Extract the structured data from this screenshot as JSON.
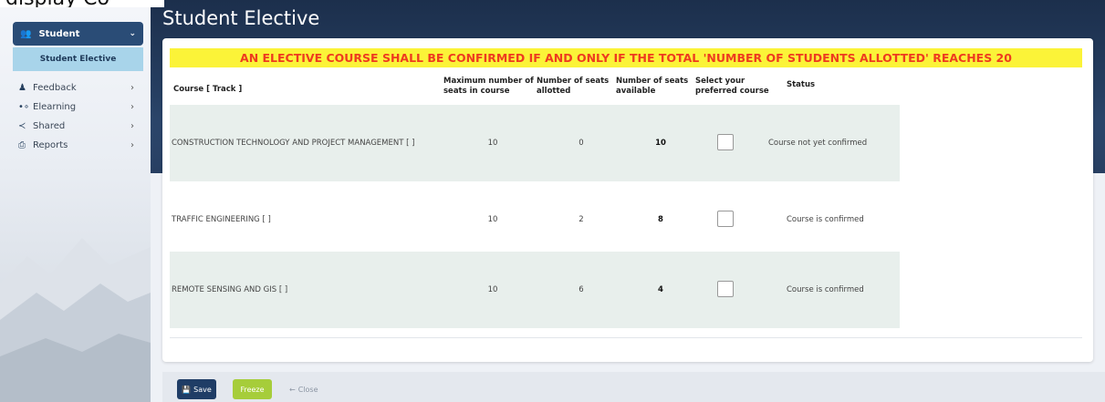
{
  "page": {
    "title": "Student Elective"
  },
  "top_clip_text": "display Co",
  "sidebar": {
    "active": {
      "label": "Student",
      "icon": "users-icon"
    },
    "sub_item": {
      "label": "Student Elective"
    },
    "items": [
      {
        "label": "Feedback",
        "icon": "person-icon"
      },
      {
        "label": "Elearning",
        "icon": "elearning-icon"
      },
      {
        "label": "Shared",
        "icon": "share-icon"
      },
      {
        "label": "Reports",
        "icon": "printer-icon"
      }
    ]
  },
  "banner": "AN ELECTIVE COURSE SHALL BE CONFIRMED IF AND ONLY IF THE TOTAL 'NUMBER OF STUDENTS ALLOTTED' REACHES 20",
  "table": {
    "headers": {
      "course": "Course [ Track ]",
      "max_seats_1": "Maximum number of",
      "max_seats_2": "seats in course",
      "allotted_1": "Number of seats",
      "allotted_2": "allotted",
      "available_1": "Number of seats",
      "available_2": "available",
      "select_1": "Select your",
      "select_2": "preferred course",
      "status": "Status"
    },
    "rows": [
      {
        "course": "CONSTRUCTION TECHNOLOGY AND PROJECT MANAGEMENT [ ]",
        "max": "10",
        "allotted": "0",
        "available": "10",
        "status": "Course not yet confirmed"
      },
      {
        "course": "TRAFFIC ENGINEERING [ ]",
        "max": "10",
        "allotted": "2",
        "available": "8",
        "status": "Course is confirmed"
      },
      {
        "course": "REMOTE SENSING AND GIS [ ]",
        "max": "10",
        "allotted": "6",
        "available": "4",
        "status": "Course is confirmed"
      }
    ]
  },
  "footer": {
    "save": "Save",
    "freeze": "Freeze",
    "close": "Close"
  },
  "colors": {
    "banner_bg": "#fbf338",
    "banner_text": "#ee3b1f",
    "primary": "#1f3d66",
    "freeze": "#a6cd3a"
  }
}
